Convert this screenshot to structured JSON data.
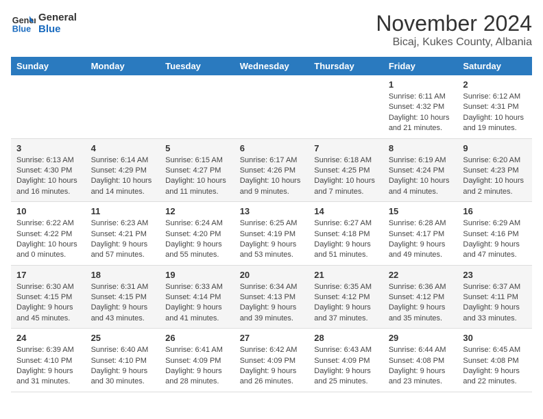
{
  "logo": {
    "line1": "General",
    "line2": "Blue"
  },
  "title": "November 2024",
  "location": "Bicaj, Kukes County, Albania",
  "days_of_week": [
    "Sunday",
    "Monday",
    "Tuesday",
    "Wednesday",
    "Thursday",
    "Friday",
    "Saturday"
  ],
  "weeks": [
    [
      {
        "day": "",
        "info": ""
      },
      {
        "day": "",
        "info": ""
      },
      {
        "day": "",
        "info": ""
      },
      {
        "day": "",
        "info": ""
      },
      {
        "day": "",
        "info": ""
      },
      {
        "day": "1",
        "info": "Sunrise: 6:11 AM\nSunset: 4:32 PM\nDaylight: 10 hours and 21 minutes."
      },
      {
        "day": "2",
        "info": "Sunrise: 6:12 AM\nSunset: 4:31 PM\nDaylight: 10 hours and 19 minutes."
      }
    ],
    [
      {
        "day": "3",
        "info": "Sunrise: 6:13 AM\nSunset: 4:30 PM\nDaylight: 10 hours and 16 minutes."
      },
      {
        "day": "4",
        "info": "Sunrise: 6:14 AM\nSunset: 4:29 PM\nDaylight: 10 hours and 14 minutes."
      },
      {
        "day": "5",
        "info": "Sunrise: 6:15 AM\nSunset: 4:27 PM\nDaylight: 10 hours and 11 minutes."
      },
      {
        "day": "6",
        "info": "Sunrise: 6:17 AM\nSunset: 4:26 PM\nDaylight: 10 hours and 9 minutes."
      },
      {
        "day": "7",
        "info": "Sunrise: 6:18 AM\nSunset: 4:25 PM\nDaylight: 10 hours and 7 minutes."
      },
      {
        "day": "8",
        "info": "Sunrise: 6:19 AM\nSunset: 4:24 PM\nDaylight: 10 hours and 4 minutes."
      },
      {
        "day": "9",
        "info": "Sunrise: 6:20 AM\nSunset: 4:23 PM\nDaylight: 10 hours and 2 minutes."
      }
    ],
    [
      {
        "day": "10",
        "info": "Sunrise: 6:22 AM\nSunset: 4:22 PM\nDaylight: 10 hours and 0 minutes."
      },
      {
        "day": "11",
        "info": "Sunrise: 6:23 AM\nSunset: 4:21 PM\nDaylight: 9 hours and 57 minutes."
      },
      {
        "day": "12",
        "info": "Sunrise: 6:24 AM\nSunset: 4:20 PM\nDaylight: 9 hours and 55 minutes."
      },
      {
        "day": "13",
        "info": "Sunrise: 6:25 AM\nSunset: 4:19 PM\nDaylight: 9 hours and 53 minutes."
      },
      {
        "day": "14",
        "info": "Sunrise: 6:27 AM\nSunset: 4:18 PM\nDaylight: 9 hours and 51 minutes."
      },
      {
        "day": "15",
        "info": "Sunrise: 6:28 AM\nSunset: 4:17 PM\nDaylight: 9 hours and 49 minutes."
      },
      {
        "day": "16",
        "info": "Sunrise: 6:29 AM\nSunset: 4:16 PM\nDaylight: 9 hours and 47 minutes."
      }
    ],
    [
      {
        "day": "17",
        "info": "Sunrise: 6:30 AM\nSunset: 4:15 PM\nDaylight: 9 hours and 45 minutes."
      },
      {
        "day": "18",
        "info": "Sunrise: 6:31 AM\nSunset: 4:15 PM\nDaylight: 9 hours and 43 minutes."
      },
      {
        "day": "19",
        "info": "Sunrise: 6:33 AM\nSunset: 4:14 PM\nDaylight: 9 hours and 41 minutes."
      },
      {
        "day": "20",
        "info": "Sunrise: 6:34 AM\nSunset: 4:13 PM\nDaylight: 9 hours and 39 minutes."
      },
      {
        "day": "21",
        "info": "Sunrise: 6:35 AM\nSunset: 4:12 PM\nDaylight: 9 hours and 37 minutes."
      },
      {
        "day": "22",
        "info": "Sunrise: 6:36 AM\nSunset: 4:12 PM\nDaylight: 9 hours and 35 minutes."
      },
      {
        "day": "23",
        "info": "Sunrise: 6:37 AM\nSunset: 4:11 PM\nDaylight: 9 hours and 33 minutes."
      }
    ],
    [
      {
        "day": "24",
        "info": "Sunrise: 6:39 AM\nSunset: 4:10 PM\nDaylight: 9 hours and 31 minutes."
      },
      {
        "day": "25",
        "info": "Sunrise: 6:40 AM\nSunset: 4:10 PM\nDaylight: 9 hours and 30 minutes."
      },
      {
        "day": "26",
        "info": "Sunrise: 6:41 AM\nSunset: 4:09 PM\nDaylight: 9 hours and 28 minutes."
      },
      {
        "day": "27",
        "info": "Sunrise: 6:42 AM\nSunset: 4:09 PM\nDaylight: 9 hours and 26 minutes."
      },
      {
        "day": "28",
        "info": "Sunrise: 6:43 AM\nSunset: 4:09 PM\nDaylight: 9 hours and 25 minutes."
      },
      {
        "day": "29",
        "info": "Sunrise: 6:44 AM\nSunset: 4:08 PM\nDaylight: 9 hours and 23 minutes."
      },
      {
        "day": "30",
        "info": "Sunrise: 6:45 AM\nSunset: 4:08 PM\nDaylight: 9 hours and 22 minutes."
      }
    ]
  ]
}
